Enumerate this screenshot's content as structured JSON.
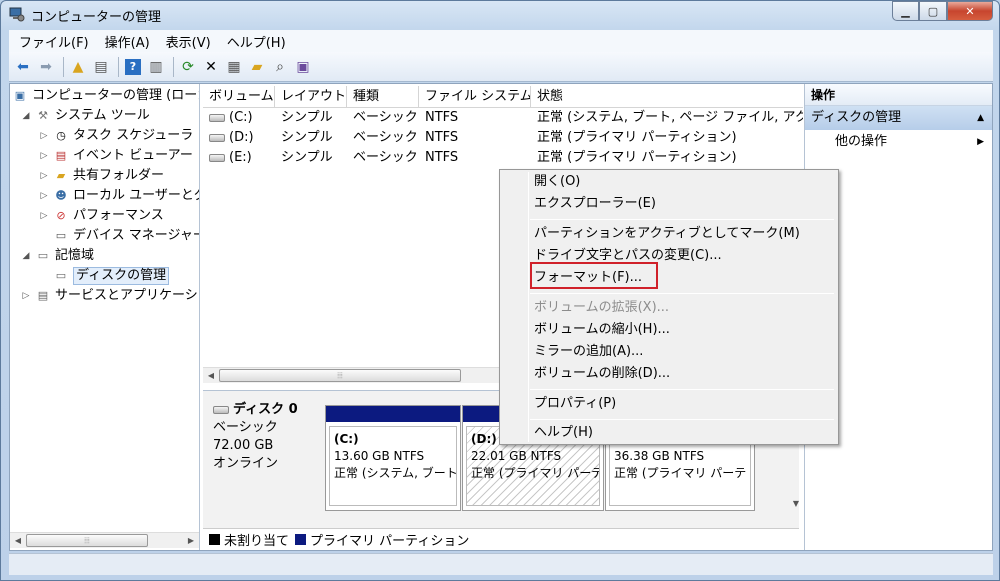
{
  "window": {
    "title": "コンピューターの管理"
  },
  "menu": [
    "ファイル(F)",
    "操作(A)",
    "表示(V)",
    "ヘルプ(H)"
  ],
  "tree": {
    "root": "コンピューターの管理 (ローカ",
    "system_tools": "システム ツール",
    "task_scheduler": "タスク スケジューラ",
    "event_viewer": "イベント ビューアー",
    "shared_folders": "共有フォルダー",
    "local_users": "ローカル ユーザーとグ",
    "performance": "パフォーマンス",
    "device_manager": "デバイス マネージャー",
    "storage": "記憶域",
    "disk_management": "ディスクの管理",
    "services": "サービスとアプリケーショ"
  },
  "volumes": {
    "headers": [
      "ボリューム",
      "レイアウト",
      "種類",
      "ファイル システム",
      "状態"
    ],
    "rows": [
      [
        "(C:)",
        "シンプル",
        "ベーシック",
        "NTFS",
        "正常 (システム, ブート, ページ ファイル, アクラ"
      ],
      [
        "(D:)",
        "シンプル",
        "ベーシック",
        "NTFS",
        "正常 (プライマリ パーティション)"
      ],
      [
        "(E:)",
        "シンプル",
        "ベーシック",
        "NTFS",
        "正常 (プライマリ パーティション)"
      ]
    ]
  },
  "disk": {
    "name": "ディスク 0",
    "type": "ベーシック",
    "size": "72.00 GB",
    "status": "オンライン",
    "partitions": [
      {
        "label": "(C:)",
        "size": "13.60 GB NTFS",
        "status": "正常 (システム, ブート"
      },
      {
        "label": "(D:)",
        "size": "22.01 GB NTFS",
        "status": "正常 (プライマリ パーテ"
      },
      {
        "label": "",
        "size": "36.38 GB NTFS",
        "status": "正常 (プライマリ パーテ"
      }
    ]
  },
  "legend": {
    "unallocated": "未割り当て",
    "primary": "プライマリ パーティション"
  },
  "actions": {
    "header": "操作",
    "section": "ディスクの管理",
    "other": "他の操作"
  },
  "context_menu": {
    "open": "開く(O)",
    "explore": "エクスプローラー(E)",
    "mark_active": "パーティションをアクティブとしてマーク(M)",
    "change_letter": "ドライブ文字とパスの変更(C)...",
    "format": "フォーマット(F)...",
    "extend": "ボリュームの拡張(X)...",
    "shrink": "ボリュームの縮小(H)...",
    "add_mirror": "ミラーの追加(A)...",
    "delete": "ボリュームの削除(D)...",
    "properties": "プロパティ(P)",
    "help": "ヘルプ(H)"
  },
  "colors": {
    "primary_partition": "#0c1a80",
    "unallocated": "#000000",
    "highlight": "#d0212a"
  }
}
